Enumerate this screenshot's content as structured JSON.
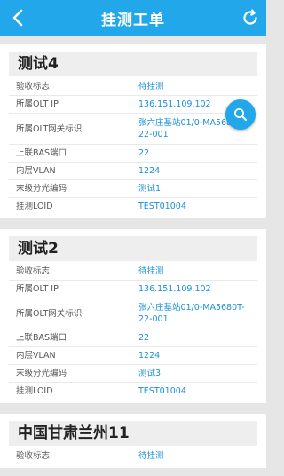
{
  "header": {
    "title": "挂测工单",
    "back_icon": "chevron-left-icon",
    "refresh_icon": "refresh-icon",
    "bg_color": "#21a7ea"
  },
  "search_fab": {
    "icon": "search-icon"
  },
  "cards": [
    {
      "title": "测试4",
      "rows": [
        {
          "label": "验收标志",
          "value": "待挂测"
        },
        {
          "label": "所属OLT IP",
          "value": "136.151.109.102"
        },
        {
          "label": "所属OLT网关标识",
          "value": "张六庄基站01/0-MA5680T-22-001"
        },
        {
          "label": "上联BAS端口",
          "value": "22"
        },
        {
          "label": "内层VLAN",
          "value": "1224"
        },
        {
          "label": "末级分光编码",
          "value": "测试1"
        },
        {
          "label": "挂测LOID",
          "value": "TEST01004"
        }
      ]
    },
    {
      "title": "测试2",
      "rows": [
        {
          "label": "验收标志",
          "value": "待挂测"
        },
        {
          "label": "所属OLT IP",
          "value": "136.151.109.102"
        },
        {
          "label": "所属OLT网关标识",
          "value": "张六庄基站01/0-MA5680T-22-001"
        },
        {
          "label": "上联BAS端口",
          "value": "22"
        },
        {
          "label": "内层VLAN",
          "value": "1224"
        },
        {
          "label": "末级分光编码",
          "value": "测试3"
        },
        {
          "label": "挂测LOID",
          "value": "TEST01004"
        }
      ]
    },
    {
      "title": "中国甘肃兰州11",
      "rows": [
        {
          "label": "验收标志",
          "value": "待挂测"
        }
      ]
    }
  ]
}
